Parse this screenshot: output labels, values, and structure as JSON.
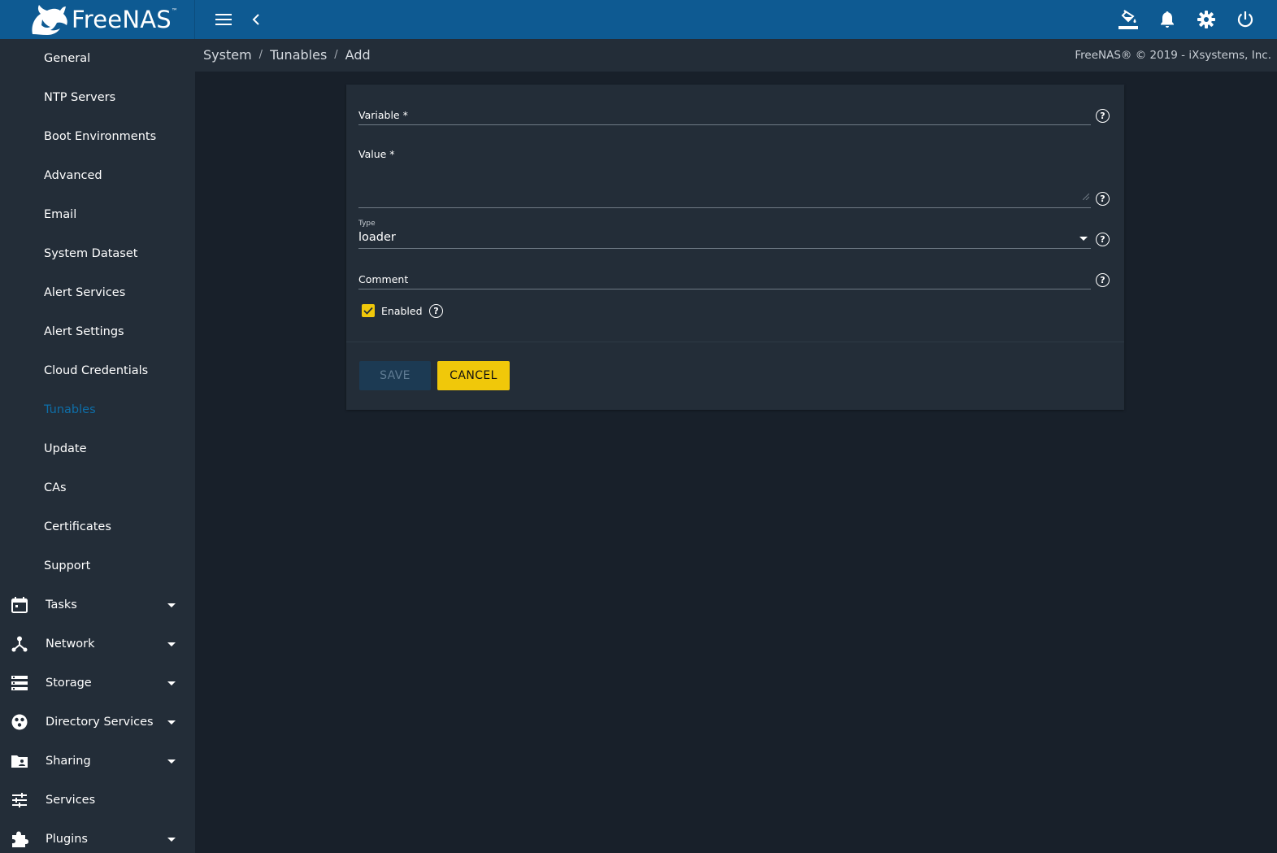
{
  "app": {
    "brand": "FreeNAS",
    "brand_tm": "™"
  },
  "topbar": {
    "icons": [
      "menu-icon",
      "chevron-left-icon",
      "paint-bucket-icon",
      "bell-icon",
      "gear-icon",
      "power-icon"
    ]
  },
  "sidebar": {
    "sub_items": [
      {
        "label": "General"
      },
      {
        "label": "NTP Servers"
      },
      {
        "label": "Boot Environments"
      },
      {
        "label": "Advanced"
      },
      {
        "label": "Email"
      },
      {
        "label": "System Dataset"
      },
      {
        "label": "Alert Services"
      },
      {
        "label": "Alert Settings"
      },
      {
        "label": "Cloud Credentials"
      },
      {
        "label": "Tunables",
        "active": true
      },
      {
        "label": "Update"
      },
      {
        "label": "CAs"
      },
      {
        "label": "Certificates"
      },
      {
        "label": "Support"
      }
    ],
    "main_items": [
      {
        "label": "Tasks",
        "icon": "calendar-icon",
        "expandable": true
      },
      {
        "label": "Network",
        "icon": "network-icon",
        "expandable": true
      },
      {
        "label": "Storage",
        "icon": "storage-icon",
        "expandable": true
      },
      {
        "label": "Directory Services",
        "icon": "directory-services-icon",
        "expandable": true
      },
      {
        "label": "Sharing",
        "icon": "sharing-folder-icon",
        "expandable": true
      },
      {
        "label": "Services",
        "icon": "sliders-icon",
        "expandable": false
      },
      {
        "label": "Plugins",
        "icon": "puzzle-icon",
        "expandable": true
      }
    ]
  },
  "breadcrumb": {
    "items": [
      "System",
      "Tunables",
      "Add"
    ],
    "separator": "/"
  },
  "copyright": "FreeNAS® © 2019 - iXsystems, Inc.",
  "form": {
    "variable_label": "Variable *",
    "variable_value": "",
    "value_label": "Value *",
    "value_value": "",
    "type_label": "Type",
    "type_value": "loader",
    "comment_label": "Comment",
    "comment_value": "",
    "enabled_label": "Enabled",
    "enabled_checked": true,
    "help_glyph": "?",
    "save_label": "SAVE",
    "cancel_label": "CANCEL"
  },
  "colors": {
    "topbar": "#0e5a92",
    "sidebar": "#232d38",
    "background": "#18202a",
    "accent_yellow": "#f0c80a",
    "active_link": "#0e6ea8"
  }
}
